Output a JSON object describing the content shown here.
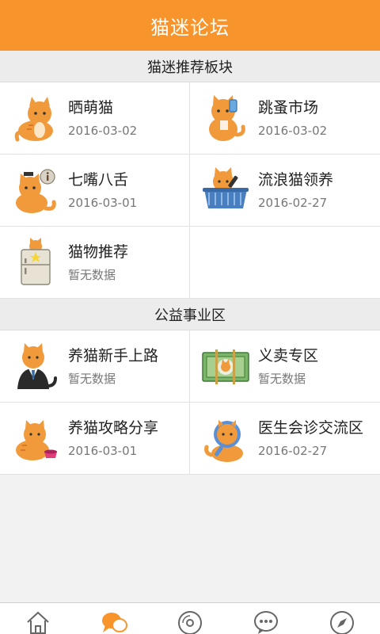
{
  "header": {
    "title": "猫迷论坛"
  },
  "sections": [
    {
      "title": "猫迷推荐板块",
      "items": [
        {
          "name": "晒萌猫",
          "date": "2016-03-02",
          "icon": "cat-sitting-icon"
        },
        {
          "name": "跳蚤市场",
          "date": "2016-03-02",
          "icon": "cat-phone-icon"
        },
        {
          "name": "七嘴八舌",
          "date": "2016-03-01",
          "icon": "cat-info-icon"
        },
        {
          "name": "流浪猫领养",
          "date": "2016-02-27",
          "icon": "cat-basket-icon"
        },
        {
          "name": "猫物推荐",
          "date": "暂无数据",
          "icon": "cat-fridge-icon"
        }
      ]
    },
    {
      "title": "公益事业区",
      "items": [
        {
          "name": "养猫新手上路",
          "date": "暂无数据",
          "icon": "cat-suit-icon"
        },
        {
          "name": "义卖专区",
          "date": "暂无数据",
          "icon": "cat-money-icon"
        },
        {
          "name": "养猫攻略分享",
          "date": "2016-03-01",
          "icon": "cat-bowl-icon"
        },
        {
          "name": "医生会诊交流区",
          "date": "2016-02-27",
          "icon": "cat-magnifier-icon"
        }
      ]
    }
  ],
  "tabs": [
    {
      "icon": "home-icon",
      "active": false
    },
    {
      "icon": "chat-bubbles-icon",
      "active": true
    },
    {
      "icon": "disc-icon",
      "active": false
    },
    {
      "icon": "more-bubble-icon",
      "active": false
    },
    {
      "icon": "compass-icon",
      "active": false
    }
  ],
  "colors": {
    "accent": "#f7942b",
    "cat": "#f09a3c",
    "inactive": "#666666"
  }
}
